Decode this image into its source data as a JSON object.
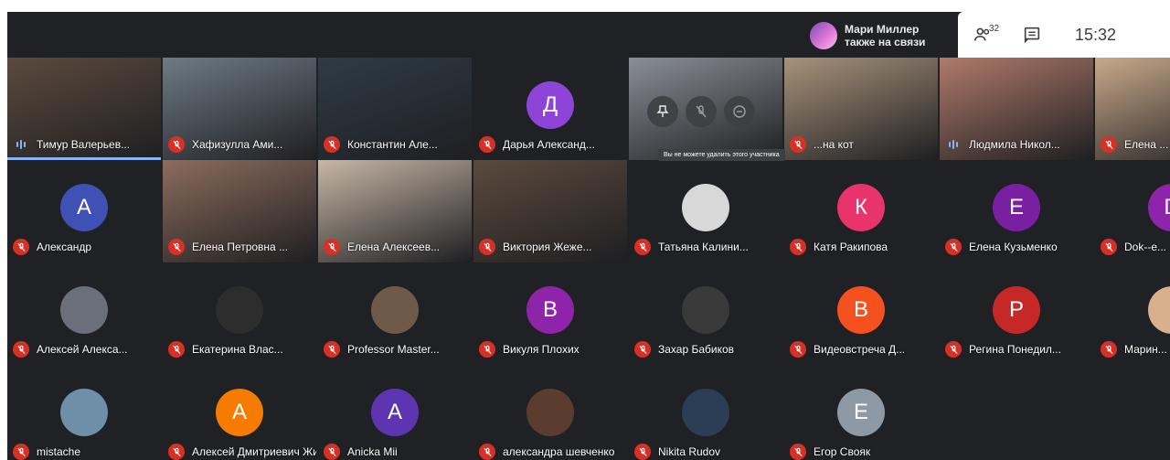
{
  "top": {
    "presenter_line1": "Мари Миллер",
    "presenter_line2": "также на связи",
    "participants_count": "32",
    "time": "15:32"
  },
  "tooltip": "Вы не можете удалить этого участника",
  "participants": [
    {
      "name": "Тимур Валерьев..."
    },
    {
      "name": "Хафизулла Ами..."
    },
    {
      "name": "Константин Але..."
    },
    {
      "name": "Дарья Александ...",
      "initial": "Д",
      "color": "#8e44d6"
    },
    {
      "name": "",
      "initial": "",
      "color": ""
    },
    {
      "name": "...на кот"
    },
    {
      "name": "Людмила Никол..."
    },
    {
      "name": "Елена ..."
    },
    {
      "name": "Александр",
      "initial": "А",
      "color": "#3f51b5"
    },
    {
      "name": "Елена Петровна ..."
    },
    {
      "name": "Елена Алексеев..."
    },
    {
      "name": "Виктория Жеже..."
    },
    {
      "name": "Татьяна Калини..."
    },
    {
      "name": "Катя Ракипова",
      "initial": "К",
      "color": "#e8336d"
    },
    {
      "name": "Елена Кузьменко",
      "initial": "Е",
      "color": "#7b1fa2"
    },
    {
      "name": "Dok--e...",
      "initial": "D",
      "color": "#8e24aa"
    },
    {
      "name": "Алексей Алекса..."
    },
    {
      "name": "Екатерина Влас..."
    },
    {
      "name": "Professor Master..."
    },
    {
      "name": "Викуля Плохих",
      "initial": "В",
      "color": "#8e24aa"
    },
    {
      "name": "Захар Бабиков"
    },
    {
      "name": "Видеовстреча Д...",
      "initial": "В",
      "color": "#f4511e"
    },
    {
      "name": "Регина Понедил...",
      "initial": "Р",
      "color": "#c62828"
    },
    {
      "name": "Марин..."
    },
    {
      "name": "mistache"
    },
    {
      "name": "Алексей Дмитриевич Жи...",
      "initial": "А",
      "color": "#f57c00"
    },
    {
      "name": "Anicka Mii",
      "initial": "А",
      "color": "#5e35b1"
    },
    {
      "name": "александра шевченко"
    },
    {
      "name": "Nikita Rudov"
    },
    {
      "name": "Егор Свояк",
      "initial": "Е",
      "color": "#8d9aa6"
    }
  ]
}
